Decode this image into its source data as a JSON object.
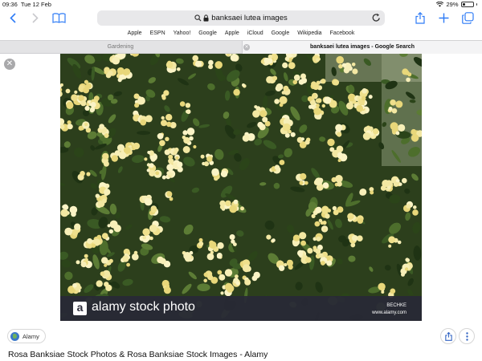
{
  "status": {
    "time": "09:36",
    "date": "Tue 12 Feb",
    "battery": "29%",
    "battery_level": 0.29
  },
  "toolbar": {
    "url_text": "banksaei lutea images"
  },
  "favorites": [
    "Apple",
    "ESPN",
    "Yahoo!",
    "Google",
    "Apple",
    "iCloud",
    "Google",
    "Wikipedia",
    "Facebook"
  ],
  "tabs": [
    {
      "label": "Gardening"
    },
    {
      "label": "banksaei lutea images - Google Search"
    }
  ],
  "image": {
    "watermark": "alamy stock photo",
    "watermark_logo": "a",
    "author": "BECHKE",
    "site": "www.alamy.com",
    "colors": {
      "foliage": "#2f4a1e",
      "flower": "#f0e59a",
      "watermark_bar": "#2d2d3b"
    }
  },
  "source": {
    "name": "Alamy"
  },
  "result_title": "Rosa Banksiae Stock Photos & Rosa Banksiae Stock Images - Alamy",
  "icons": [
    "back-icon",
    "forward-icon",
    "bookmarks-icon",
    "search-icon",
    "lock-icon",
    "reload-icon",
    "share-icon",
    "new-tab-icon",
    "tabs-icon",
    "close-icon",
    "globe-icon",
    "more-icon"
  ],
  "accent_color": "#2f7cf6"
}
